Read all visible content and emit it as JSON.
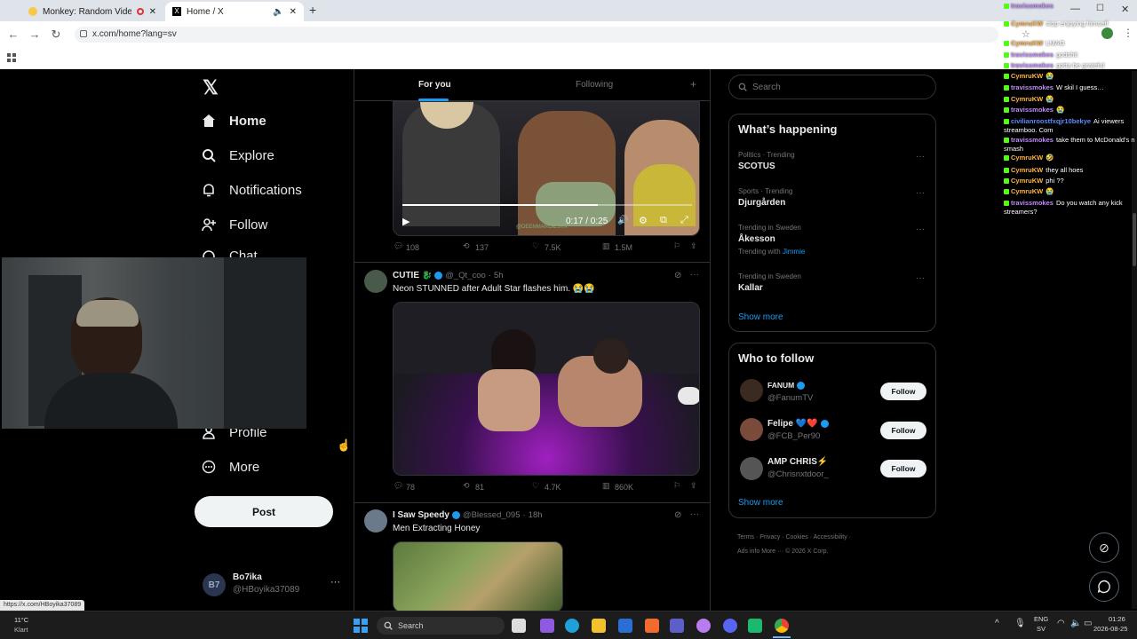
{
  "browser": {
    "tabs": [
      {
        "title": "Monkey: Random Video Ch",
        "active": false
      },
      {
        "title": "Home / X",
        "active": true
      }
    ],
    "url": "x.com/home?lang=sv",
    "status_url": "https://x.com/HBoyika37089"
  },
  "nav": {
    "items": [
      "Home",
      "Explore",
      "Notifications",
      "Follow",
      "Chat",
      "Profile",
      "More"
    ],
    "post_label": "Post",
    "account": {
      "name": "Bo7ika",
      "handle": "@HBoyika37089"
    }
  },
  "feed": {
    "tabs": [
      "For you",
      "Following"
    ],
    "tweets": [
      {
        "video_time": "0:17 / 0:25",
        "watermark": "@DEENMARCIESTX",
        "replies": "108",
        "retweets": "137",
        "likes": "7.5K",
        "views": "1.5M"
      },
      {
        "name": "CUTIE",
        "name_emoji": "🐉",
        "handle": "@_Qt_coo",
        "time": "5h",
        "text": "Neon STUNNED after Adult Star flashes him. 😭😭",
        "replies": "78",
        "retweets": "81",
        "likes": "4.7K",
        "views": "860K"
      },
      {
        "name": "I Saw Speedy",
        "handle": "@Blessed_095",
        "time": "18h",
        "text": "Men Extracting Honey"
      }
    ]
  },
  "sidebar": {
    "search_placeholder": "Search",
    "happening_title": "What’s happening",
    "trends": [
      {
        "meta": "Politics · Trending",
        "name": "SCOTUS"
      },
      {
        "meta": "Sports · Trending",
        "name": "Djurgården"
      },
      {
        "meta": "Trending in Sweden",
        "name": "Åkesson",
        "extra_prefix": "Trending with",
        "extra_link": "Jimmie"
      },
      {
        "meta": "Trending in Sweden",
        "name": "Kallar"
      }
    ],
    "show_more": "Show more",
    "who_title": "Who to follow",
    "who": [
      {
        "name": "FANUM",
        "handle": "@FanumTV",
        "button": "Follow"
      },
      {
        "name": "Felipe 💙❤️",
        "handle": "@FCB_Per90",
        "button": "Follow"
      },
      {
        "name": "AMP CHRIS⚡",
        "handle": "@Chrisnxtdoor_",
        "button": "Follow"
      }
    ],
    "show_more2": "Show more",
    "footer": [
      "Terms",
      "Privacy",
      "Cookies",
      "Accessibility",
      "Ads info",
      "More ···",
      "© 2026 X Corp."
    ]
  },
  "chat": [
    {
      "user": "travissmokes",
      "msg": ""
    },
    {
      "user": "CymruKW",
      "msg": "stop enjoying himself"
    },
    {
      "user": "CymruKW",
      "msg": "LMAO"
    },
    {
      "user": "travissmokes",
      "msg": "godshit"
    },
    {
      "user": "travissmokes",
      "msg": "gotta be grateful"
    },
    {
      "user": "CymruKW",
      "msg": "😭"
    },
    {
      "user": "travissmokes",
      "msg": "W skil I guess…"
    },
    {
      "user": "CymruKW",
      "msg": "😭"
    },
    {
      "user": "travissmokes",
      "msg": "😭"
    },
    {
      "user": "civilianroostfxqjr10bekye",
      "msg": "Ai viewers streamboo. Com"
    },
    {
      "user": "travissmokes",
      "msg": "take them to McDonald's n smash"
    },
    {
      "user": "CymruKW",
      "msg": "🤣"
    },
    {
      "user": "CymruKW",
      "msg": "they all hoes"
    },
    {
      "user": "CymruKW",
      "msg": "phi ??"
    },
    {
      "user": "CymruKW",
      "msg": "😭"
    },
    {
      "user": "travissmokes",
      "msg": "Do you watch any kick streamers?"
    }
  ],
  "taskbar": {
    "weather_temp": "11°C",
    "weather_desc": "Klart",
    "search": "Search",
    "lang1": "ENG",
    "lang2": "SV",
    "time": "01:26",
    "date": "2026-08-25"
  }
}
